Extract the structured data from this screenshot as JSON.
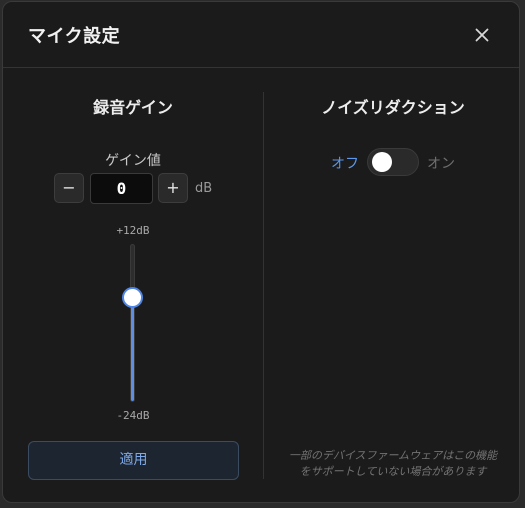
{
  "dialog": {
    "title": "マイク設定",
    "close_icon": "close-icon"
  },
  "gain": {
    "section_title": "録音ゲイン",
    "label": "ゲイン値",
    "minus_label": "−",
    "plus_label": "+",
    "value": "0",
    "unit": "dB",
    "slider": {
      "max_label": "+12dB",
      "min_label": "-24dB",
      "min": -24,
      "max": 12,
      "value": 0
    },
    "apply_label": "適用"
  },
  "noise_reduction": {
    "section_title": "ノイズリダクション",
    "off_label": "オフ",
    "on_label": "オン",
    "enabled": false,
    "note_line1": "一部のデバイスファームウェアはこの機能",
    "note_line2": "をサポートしていない場合があります"
  },
  "colors": {
    "accent": "#5e8fe3",
    "dialog_bg": "#1b1b1b",
    "text": "#ededed"
  }
}
